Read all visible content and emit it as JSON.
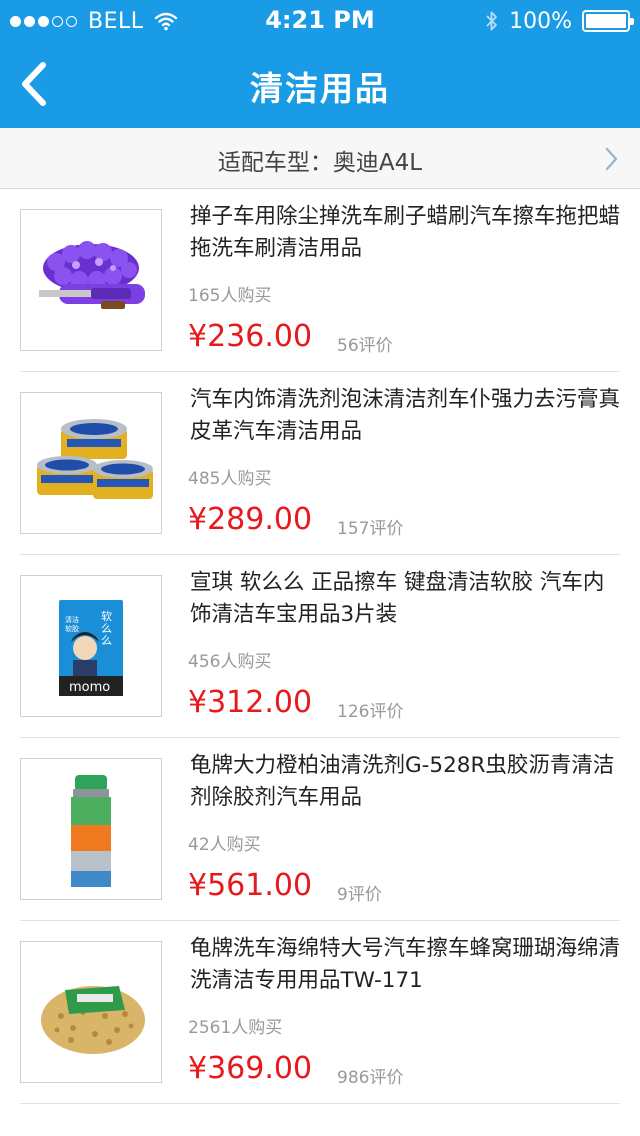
{
  "status_bar": {
    "carrier": "BELL",
    "time": "4:21 PM",
    "battery": "100%",
    "battery_level": 1.0
  },
  "nav": {
    "title": "清洁用品"
  },
  "fit_bar": {
    "text": "适配车型：奥迪A4L"
  },
  "products": [
    {
      "title": "掸子车用除尘掸洗车刷子蜡刷汽车擦车拖把蜡拖洗车刷清洁用品",
      "buyers": "165人购买",
      "price": "¥236.00",
      "reviews": "56评价",
      "image": "purple-chenille-duster"
    },
    {
      "title": "汽车内饰清洗剂泡沫清洁剂车仆强力去污膏真皮革汽车清洁用品",
      "buyers": "485人购买",
      "price": "¥289.00",
      "reviews": "157评价",
      "image": "cleaning-paste-tins"
    },
    {
      "title": "宣琪 软么么 正品擦车 键盘清洁软胶 汽车内饰清洁车宝用品3片装",
      "buyers": "456人购买",
      "price": "¥312.00",
      "reviews": "126评价",
      "image": "momo-gel-pack",
      "image_labels": {
        "brand": "momo",
        "side_text": "清洁软胶",
        "vertical_text": "软么么"
      }
    },
    {
      "title": "龟牌大力橙柏油清洗剂G-528R虫胶沥青清洁剂除胶剂汽车用品",
      "buyers": "42人购买",
      "price": "¥561.00",
      "reviews": "9评价",
      "image": "spray-can"
    },
    {
      "title": "龟牌洗车海绵特大号汽车擦车蜂窝珊瑚海绵清洗清洁专用用品TW-171",
      "buyers": "2561人购买",
      "price": "¥369.00",
      "reviews": "986评价",
      "image": "wash-sponge"
    }
  ]
}
